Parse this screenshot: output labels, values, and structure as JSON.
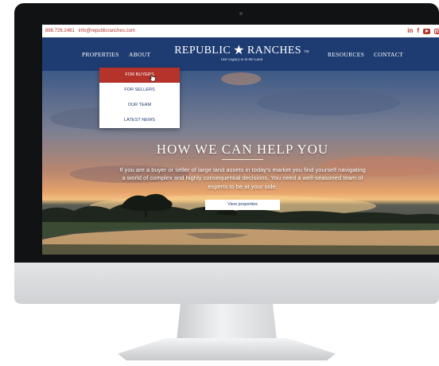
{
  "topbar": {
    "phone": "888.726.2481",
    "email": "info@republicranches.com",
    "social": [
      {
        "icon": "linkedin-icon",
        "glyph": "in"
      },
      {
        "icon": "facebook-icon",
        "glyph": "f"
      },
      {
        "icon": "youtube-icon",
        "glyph": ""
      },
      {
        "icon": "instagram-icon",
        "glyph": ""
      }
    ]
  },
  "nav": {
    "properties": "PROPERTIES",
    "about": "ABOUT",
    "resources": "RESOURCES",
    "contact": "CONTACT",
    "logo": {
      "left": "REPUBLIC",
      "right": "RANCHES",
      "mark": "TM",
      "tagline": "Our Legacy is in the Land"
    }
  },
  "dropdown": {
    "items": [
      "FOR BUYERS",
      "FOR SELLERS",
      "OUR TEAM",
      "LATEST NEWS"
    ],
    "active_index": 0
  },
  "hero": {
    "title": "HOW WE CAN HELP YOU",
    "body": "If you are a buyer or seller of large land assets in today's market you find yourself navigating a world of complex and highly consequential decisions. You need a well-seasoned team of experts to be at your side.",
    "button": "View properties"
  },
  "colors": {
    "navy": "#1f3c72",
    "accent_red": "#b5332a",
    "bezel": "#111214"
  }
}
